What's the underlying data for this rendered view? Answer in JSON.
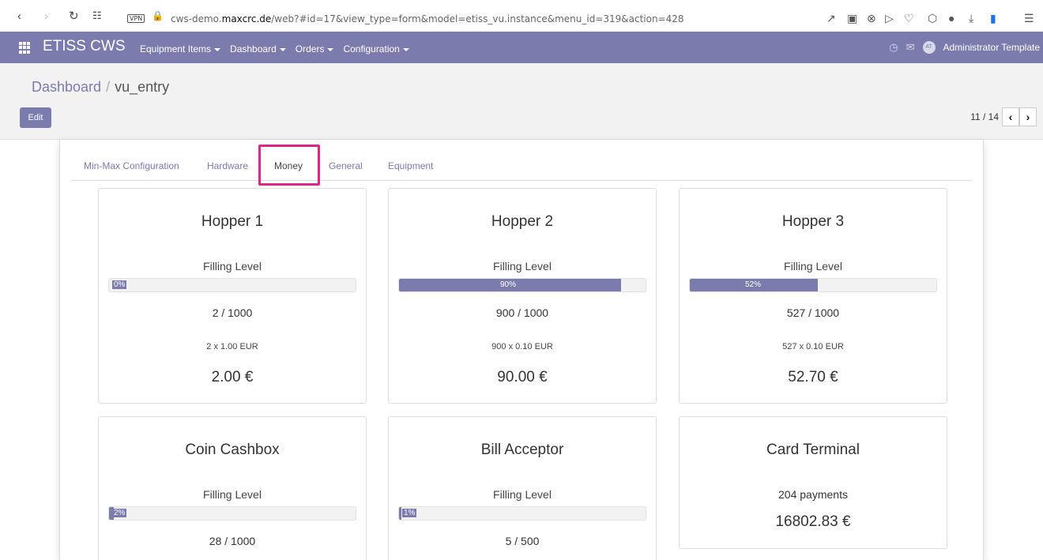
{
  "browser": {
    "vpn": "VPN",
    "url_prefix": "cws-demo.",
    "url_domain": "maxcrc.de",
    "url_rest": "/web?#id=17&view_type=form&model=etiss_vu.instance&menu_id=319&action=428"
  },
  "navbar": {
    "brand": "ETISS CWS",
    "menu": [
      "Equipment Items",
      "Dashboard",
      "Orders",
      "Configuration"
    ],
    "user": "Administrator Template",
    "accent_color": "#7c7bad"
  },
  "breadcrumb": {
    "parent": "Dashboard",
    "separator": "/",
    "current": "vu_entry"
  },
  "toolbar": {
    "edit_label": "Edit",
    "pager": "11 / 14"
  },
  "tabs": [
    {
      "label": "Min-Max Configuration"
    },
    {
      "label": "Hardware"
    },
    {
      "label": "Money",
      "active": true
    },
    {
      "label": "General"
    },
    {
      "label": "Equipment"
    }
  ],
  "highlight_color": "#e0258a",
  "cards": [
    {
      "title": "Hopper 1",
      "fill_label": "Filling Level",
      "percent": "0%",
      "fraction": 0.0,
      "count": "2 / 1000",
      "denomination": "2 x 1.00 EUR",
      "total": "2.00 €"
    },
    {
      "title": "Hopper 2",
      "fill_label": "Filling Level",
      "percent": "90%",
      "fraction": 0.9,
      "count": "900 / 1000",
      "denomination": "900 x 0.10 EUR",
      "total": "90.00 €"
    },
    {
      "title": "Hopper 3",
      "fill_label": "Filling Level",
      "percent": "52%",
      "fraction": 0.52,
      "count": "527 / 1000",
      "denomination": "527 x 0.10 EUR",
      "total": "52.70 €"
    },
    {
      "title": "Coin Cashbox",
      "fill_label": "Filling Level",
      "percent": "2%",
      "fraction": 0.02,
      "count": "28 / 1000"
    },
    {
      "title": "Bill Acceptor",
      "fill_label": "Filling Level",
      "percent": "1%",
      "fraction": 0.01,
      "count": "5 / 500"
    },
    {
      "title": "Card Terminal",
      "payments": "204 payments",
      "amount": "16802.83 €"
    }
  ]
}
